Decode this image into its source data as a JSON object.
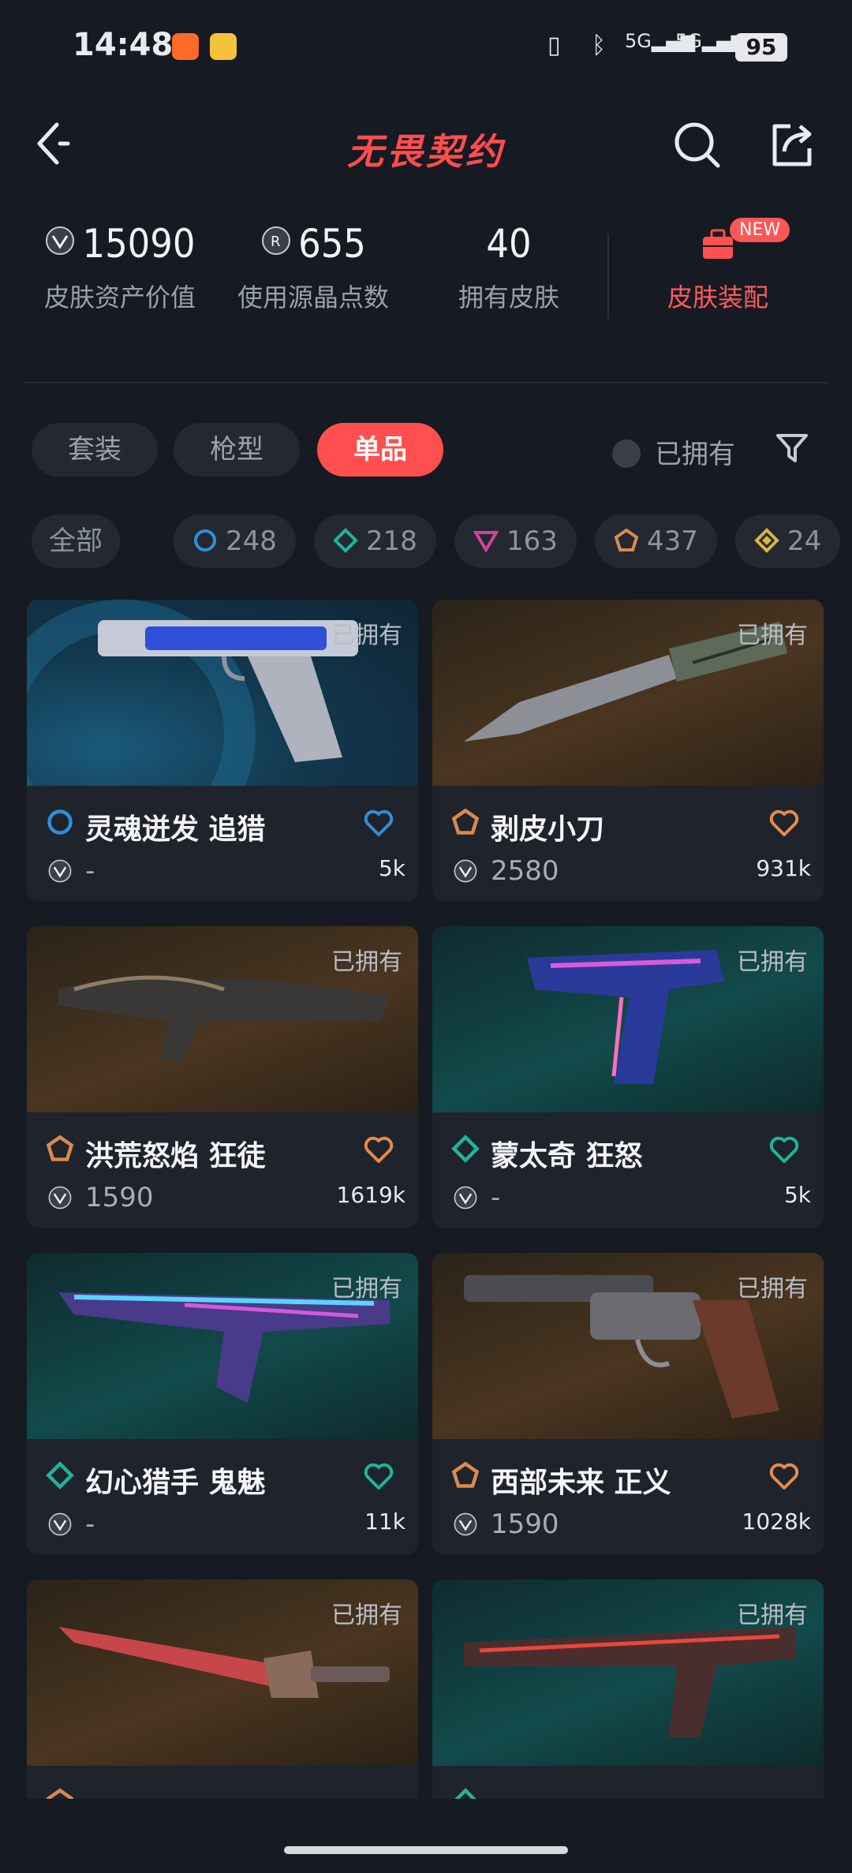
{
  "status_bar": {
    "time": "14:48",
    "network_1": "5G",
    "network_2": "5G",
    "battery": "95"
  },
  "header": {
    "logo": "无畏契约"
  },
  "stats": [
    {
      "value": "15090",
      "label": "皮肤资产价值",
      "icon": "vp-icon"
    },
    {
      "value": "655",
      "label": "使用源晶点数",
      "icon": "radianite-icon"
    },
    {
      "value": "40",
      "label": "拥有皮肤",
      "icon": ""
    }
  ],
  "equip": {
    "label": "皮肤装配",
    "badge": "NEW"
  },
  "tabs": [
    {
      "label": "套装"
    },
    {
      "label": "枪型"
    },
    {
      "label": "单品",
      "active": true
    }
  ],
  "owned_filter": {
    "label": "已拥有"
  },
  "chips": [
    {
      "label": "全部"
    },
    {
      "label": "248",
      "icon": "ultra-tier-icon",
      "color": "#2f8fd8"
    },
    {
      "label": "218",
      "icon": "premium-tier-icon",
      "color": "#1fb59b"
    },
    {
      "label": "163",
      "icon": "exclusive-tier-icon",
      "color": "#d0439a"
    },
    {
      "label": "437",
      "icon": "select-tier-icon",
      "color": "#d98a4e"
    },
    {
      "label": "24",
      "icon": "deluxe-tier-icon",
      "color": "#d7b544"
    }
  ],
  "cards": [
    {
      "owned": "已拥有",
      "name": "灵魂迸发 追猎",
      "price": "-",
      "count": "5k",
      "tier": "ultra",
      "bg": "blue",
      "heart": "#2f8fd8",
      "weapon": "pistol"
    },
    {
      "owned": "已拥有",
      "name": "剥皮小刀",
      "price": "2580",
      "count": "931k",
      "tier": "select",
      "bg": "gold",
      "heart": "#e58a4e",
      "weapon": "knife"
    },
    {
      "owned": "已拥有",
      "name": "洪荒怒焰 狂徒",
      "price": "1590",
      "count": "1619k",
      "tier": "select",
      "bg": "gold",
      "heart": "#e58a4e",
      "weapon": "rifle"
    },
    {
      "owned": "已拥有",
      "name": "蒙太奇 狂怒",
      "price": "-",
      "count": "5k",
      "tier": "premium",
      "bg": "teal",
      "heart": "#1fb59b",
      "weapon": "smg"
    },
    {
      "owned": "已拥有",
      "name": "幻心猎手 鬼魅",
      "price": "-",
      "count": "11k",
      "tier": "premium",
      "bg": "teal",
      "heart": "#1fb59b",
      "weapon": "ghost"
    },
    {
      "owned": "已拥有",
      "name": "西部未来 正义",
      "price": "1590",
      "count": "1028k",
      "tier": "select",
      "bg": "gold",
      "heart": "#e58a4e",
      "weapon": "revolver"
    },
    {
      "owned": "已拥有",
      "name": "",
      "price": "",
      "count": "",
      "tier": "select",
      "bg": "gold",
      "heart": "#e58a4e",
      "weapon": "sword"
    },
    {
      "owned": "已拥有",
      "name": "",
      "price": "",
      "count": "",
      "tier": "premium",
      "bg": "teal",
      "heart": "#1fb59b",
      "weapon": "vandal"
    }
  ]
}
